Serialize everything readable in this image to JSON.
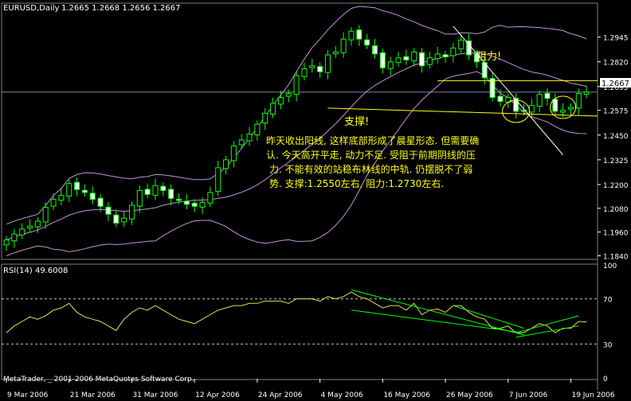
{
  "chart_data": [
    {
      "type": "candlestick",
      "symbol_header": "EURUSD,Daily",
      "ohlc_header": "1.2665 1.2668 1.2656 1.2667",
      "current_price_label": "1.2667",
      "y_ticks": [
        "1.2945",
        "1.2820",
        "1.2695",
        "1.2575",
        "1.2450",
        "1.2325",
        "1.2200",
        "1.2080",
        "1.1960",
        "1.1840"
      ],
      "y_tick_values": [
        1.2945,
        1.282,
        1.2695,
        1.2575,
        1.245,
        1.2325,
        1.22,
        1.208,
        1.196,
        1.184
      ],
      "ylim": [
        1.183,
        1.306
      ],
      "x_labels": [
        "9 Mar 2006",
        "21 Mar 2006",
        "31 Mar 2006",
        "12 Apr 2006",
        "24 Apr 2006",
        "4 May 2006",
        "16 May 2006",
        "26 May 2006",
        "7 Jun 2006",
        "19 Jun 2006"
      ],
      "x_label_index": [
        0,
        8,
        16,
        24,
        32,
        40,
        48,
        56,
        64,
        72
      ],
      "closes": [
        1.192,
        1.195,
        1.1975,
        1.199,
        1.2015,
        1.2085,
        1.2125,
        1.2145,
        1.2205,
        1.2175,
        1.216,
        1.2125,
        1.209,
        1.205,
        1.2005,
        1.203,
        1.2095,
        1.217,
        1.215,
        1.2195,
        1.217,
        1.213,
        1.212,
        1.21,
        1.209,
        1.211,
        1.216,
        1.2285,
        1.2325,
        1.2395,
        1.2425,
        1.2455,
        1.2505,
        1.256,
        1.261,
        1.264,
        1.266,
        1.275,
        1.2785,
        1.28,
        1.277,
        1.2855,
        1.287,
        1.2935,
        1.2975,
        1.2935,
        1.2905,
        1.286,
        1.279,
        1.282,
        1.284,
        1.283,
        1.287,
        1.28,
        1.284,
        1.286,
        1.2845,
        1.289,
        1.293,
        1.2855,
        1.282,
        1.274,
        1.264,
        1.262,
        1.264,
        1.257,
        1.257,
        1.26,
        1.2655,
        1.2635,
        1.257,
        1.2575,
        1.259,
        1.266,
        1.2667
      ],
      "bollinger": {
        "upper_label": "Bollinger upper",
        "middle_label": "Bollinger middle",
        "lower_label": "Bollinger lower"
      },
      "annotations": {
        "support_label": "支撑!",
        "resistance_label": "阻力!",
        "support_level": 1.2562,
        "resistance_level": 1.2725,
        "commentary": [
          "昨天收出阳线, 这样底部形成了晨星形态. 但需要确",
          "认. 今天高开平走, 动力不足. 受阻于前期阴线的压",
          "力. 不能有效的站稳布林线的中轨. 仍摆脱不了弱",
          "势. 支撑:1.2550左右, 阻力:1.2730左右."
        ]
      },
      "colors": {
        "bull": "#000000",
        "bear": "#ffffff",
        "candle_outline": "#00ff00",
        "bollinger": "#c890d8",
        "annotation": "#ffff00",
        "grid": "#c0c0c0",
        "text": "#ffffff"
      }
    },
    {
      "type": "line",
      "header": "RSI(14) 49.6008",
      "ylim": [
        0,
        100
      ],
      "y_ticks": [
        "100",
        "70",
        "30",
        "0"
      ],
      "y_tick_values": [
        100,
        70,
        30,
        0
      ],
      "levels": [
        70,
        30
      ],
      "values": [
        40,
        46,
        50,
        54,
        52,
        55,
        60,
        62,
        66,
        58,
        54,
        52,
        50,
        46,
        42,
        52,
        58,
        62,
        60,
        64,
        60,
        56,
        52,
        50,
        48,
        52,
        56,
        60,
        62,
        64,
        64,
        66,
        66,
        68,
        68,
        68,
        66,
        70,
        70,
        70,
        68,
        72,
        70,
        72,
        76,
        72,
        70,
        66,
        62,
        64,
        64,
        60,
        66,
        56,
        60,
        61,
        58,
        64,
        64,
        58,
        54,
        52,
        44,
        44,
        46,
        40,
        40,
        44,
        48,
        46,
        40,
        44,
        44,
        50,
        49.6
      ],
      "colors": {
        "line": "#e8e060",
        "trendline": "#00ff00",
        "level": "#c0c0c0"
      }
    }
  ],
  "footer": "MetaTrader, _ 2001-2006 MetaQuotes Software Corp."
}
